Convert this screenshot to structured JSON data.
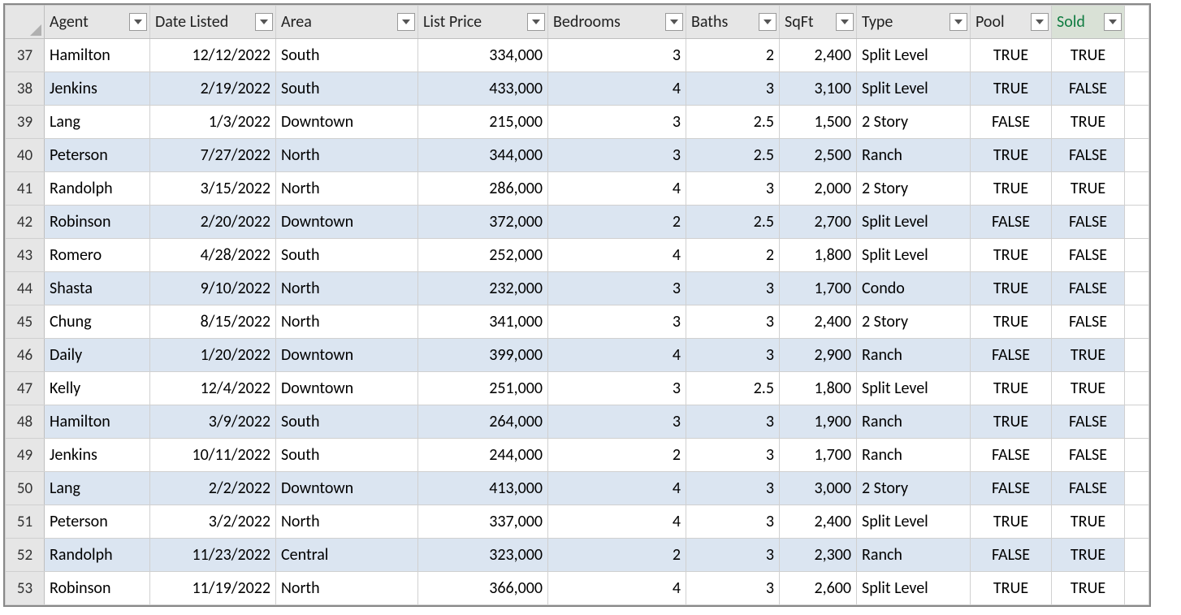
{
  "columns": [
    {
      "key": "agent",
      "label": "Agent",
      "align": "left",
      "cls": "c-agent"
    },
    {
      "key": "date",
      "label": "Date Listed",
      "align": "right",
      "cls": "c-date"
    },
    {
      "key": "area",
      "label": "Area",
      "align": "left",
      "cls": "c-area"
    },
    {
      "key": "price",
      "label": "List Price",
      "align": "right",
      "cls": "c-price"
    },
    {
      "key": "bed",
      "label": "Bedrooms",
      "align": "right",
      "cls": "c-bed"
    },
    {
      "key": "bath",
      "label": "Baths",
      "align": "right",
      "cls": "c-bath"
    },
    {
      "key": "sqft",
      "label": "SqFt",
      "align": "right",
      "cls": "c-sqft"
    },
    {
      "key": "type",
      "label": "Type",
      "align": "left",
      "cls": "c-type"
    },
    {
      "key": "pool",
      "label": "Pool",
      "align": "center",
      "cls": "c-pool"
    },
    {
      "key": "sold",
      "label": "Sold",
      "align": "center",
      "cls": "c-sold",
      "selected": true
    }
  ],
  "rows": [
    {
      "n": 37,
      "agent": "Hamilton",
      "date": "12/12/2022",
      "area": "South",
      "price": "334,000",
      "bed": "3",
      "bath": "2",
      "sqft": "2,400",
      "type": "Split Level",
      "pool": "TRUE",
      "sold": "TRUE"
    },
    {
      "n": 38,
      "agent": "Jenkins",
      "date": "2/19/2022",
      "area": "South",
      "price": "433,000",
      "bed": "4",
      "bath": "3",
      "sqft": "3,100",
      "type": "Split Level",
      "pool": "TRUE",
      "sold": "FALSE"
    },
    {
      "n": 39,
      "agent": "Lang",
      "date": "1/3/2022",
      "area": "Downtown",
      "price": "215,000",
      "bed": "3",
      "bath": "2.5",
      "sqft": "1,500",
      "type": "2 Story",
      "pool": "FALSE",
      "sold": "TRUE"
    },
    {
      "n": 40,
      "agent": "Peterson",
      "date": "7/27/2022",
      "area": "North",
      "price": "344,000",
      "bed": "3",
      "bath": "2.5",
      "sqft": "2,500",
      "type": "Ranch",
      "pool": "TRUE",
      "sold": "FALSE"
    },
    {
      "n": 41,
      "agent": "Randolph",
      "date": "3/15/2022",
      "area": "North",
      "price": "286,000",
      "bed": "4",
      "bath": "3",
      "sqft": "2,000",
      "type": "2 Story",
      "pool": "TRUE",
      "sold": "TRUE"
    },
    {
      "n": 42,
      "agent": "Robinson",
      "date": "2/20/2022",
      "area": "Downtown",
      "price": "372,000",
      "bed": "2",
      "bath": "2.5",
      "sqft": "2,700",
      "type": "Split Level",
      "pool": "FALSE",
      "sold": "FALSE"
    },
    {
      "n": 43,
      "agent": "Romero",
      "date": "4/28/2022",
      "area": "South",
      "price": "252,000",
      "bed": "4",
      "bath": "2",
      "sqft": "1,800",
      "type": "Split Level",
      "pool": "TRUE",
      "sold": "FALSE"
    },
    {
      "n": 44,
      "agent": "Shasta",
      "date": "9/10/2022",
      "area": "North",
      "price": "232,000",
      "bed": "3",
      "bath": "3",
      "sqft": "1,700",
      "type": "Condo",
      "pool": "TRUE",
      "sold": "FALSE"
    },
    {
      "n": 45,
      "agent": "Chung",
      "date": "8/15/2022",
      "area": "North",
      "price": "341,000",
      "bed": "3",
      "bath": "3",
      "sqft": "2,400",
      "type": "2 Story",
      "pool": "TRUE",
      "sold": "FALSE"
    },
    {
      "n": 46,
      "agent": "Daily",
      "date": "1/20/2022",
      "area": "Downtown",
      "price": "399,000",
      "bed": "4",
      "bath": "3",
      "sqft": "2,900",
      "type": "Ranch",
      "pool": "FALSE",
      "sold": "TRUE"
    },
    {
      "n": 47,
      "agent": "Kelly",
      "date": "12/4/2022",
      "area": "Downtown",
      "price": "251,000",
      "bed": "3",
      "bath": "2.5",
      "sqft": "1,800",
      "type": "Split Level",
      "pool": "TRUE",
      "sold": "TRUE"
    },
    {
      "n": 48,
      "agent": "Hamilton",
      "date": "3/9/2022",
      "area": "South",
      "price": "264,000",
      "bed": "3",
      "bath": "3",
      "sqft": "1,900",
      "type": "Ranch",
      "pool": "TRUE",
      "sold": "FALSE"
    },
    {
      "n": 49,
      "agent": "Jenkins",
      "date": "10/11/2022",
      "area": "South",
      "price": "244,000",
      "bed": "2",
      "bath": "3",
      "sqft": "1,700",
      "type": "Ranch",
      "pool": "FALSE",
      "sold": "FALSE"
    },
    {
      "n": 50,
      "agent": "Lang",
      "date": "2/2/2022",
      "area": "Downtown",
      "price": "413,000",
      "bed": "4",
      "bath": "3",
      "sqft": "3,000",
      "type": "2 Story",
      "pool": "FALSE",
      "sold": "FALSE"
    },
    {
      "n": 51,
      "agent": "Peterson",
      "date": "3/2/2022",
      "area": "North",
      "price": "337,000",
      "bed": "4",
      "bath": "3",
      "sqft": "2,400",
      "type": "Split Level",
      "pool": "TRUE",
      "sold": "TRUE"
    },
    {
      "n": 52,
      "agent": "Randolph",
      "date": "11/23/2022",
      "area": "Central",
      "price": "323,000",
      "bed": "2",
      "bath": "3",
      "sqft": "2,300",
      "type": "Ranch",
      "pool": "FALSE",
      "sold": "TRUE"
    },
    {
      "n": 53,
      "agent": "Robinson",
      "date": "11/19/2022",
      "area": "North",
      "price": "366,000",
      "bed": "4",
      "bath": "3",
      "sqft": "2,600",
      "type": "Split Level",
      "pool": "TRUE",
      "sold": "TRUE"
    }
  ]
}
